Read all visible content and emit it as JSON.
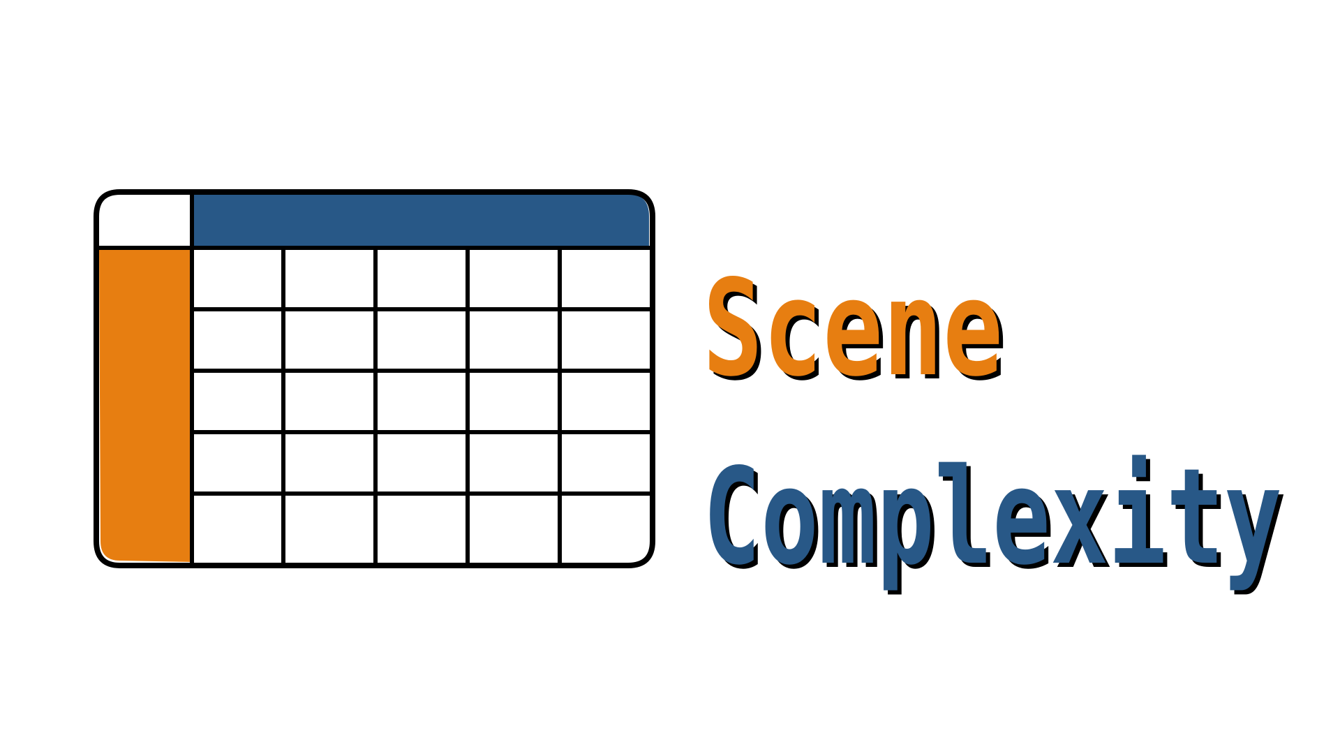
{
  "logo": {
    "icon_name": "table-grid-icon",
    "colors": {
      "outline": "#000000",
      "header_fill": "#285887",
      "side_fill": "#e77e11",
      "cell_fill": "#ffffff"
    },
    "grid": {
      "body_rows": 5,
      "body_columns": 5
    }
  },
  "title": {
    "line1": "Scene",
    "line2": "Complexity",
    "line1_color": "#e77e11",
    "line2_color": "#285887",
    "shadow_color": "#000000"
  }
}
